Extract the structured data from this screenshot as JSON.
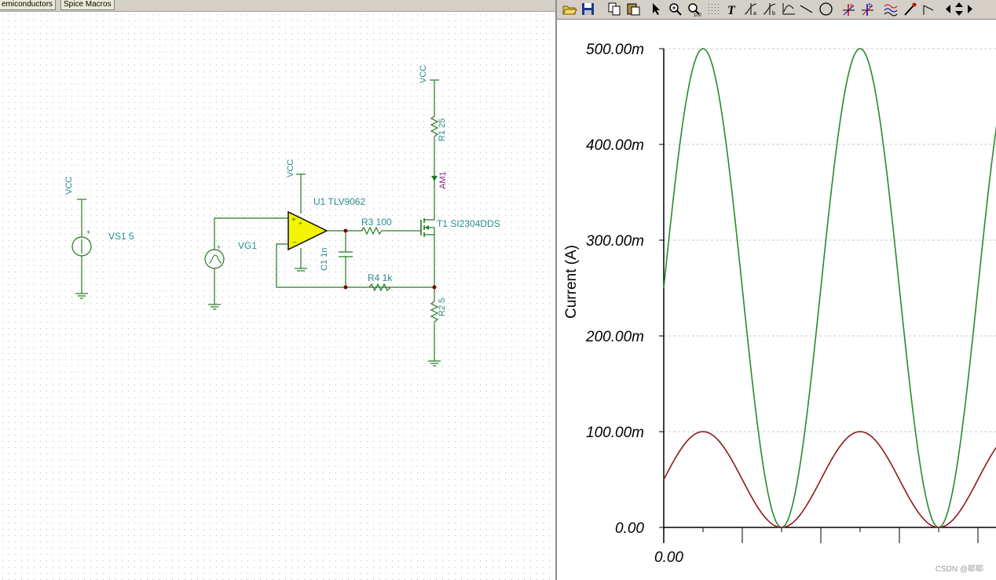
{
  "schematic": {
    "tabs": [
      {
        "label": "emiconductors"
      },
      {
        "label": "Spice Macros"
      }
    ],
    "labels": {
      "vcc1": "VCC",
      "vcc2": "VCC",
      "vcc3": "VCC",
      "vs1": "VS1 5",
      "vg1": "VG1",
      "u1": "U1 TLV9062",
      "r3": "R3 100",
      "c1": "C1 1n",
      "r4": "R4 1k",
      "r1": "R1 25",
      "am1": "AM1",
      "t1": "T1 SI2304DDS",
      "r2": "R2 5"
    },
    "colors": {
      "wire": "#207a20",
      "label": "#2a8c8c",
      "meter_label": "#8a2a8a",
      "opamp_fill": "#f5f500",
      "node": "#800000"
    }
  },
  "toolbar": {
    "buttons": [
      {
        "icon": "open-folder-icon"
      },
      {
        "icon": "save-icon"
      },
      {
        "icon": "copy-icon"
      },
      {
        "icon": "paste-icon"
      },
      {
        "icon": "pointer-icon"
      },
      {
        "icon": "zoom-in-icon"
      },
      {
        "icon": "zoom-100-icon"
      },
      {
        "icon": "grid-icon"
      },
      {
        "icon": "text-tool-icon"
      },
      {
        "icon": "cursor-a-icon"
      },
      {
        "icon": "cursor-b-icon"
      },
      {
        "icon": "axis-icon"
      },
      {
        "icon": "line-tool-icon"
      },
      {
        "icon": "ellipse-tool-icon"
      },
      {
        "icon": "cursor-a-cross-icon"
      },
      {
        "icon": "cursor-b-cross-icon"
      },
      {
        "icon": "curves-icon"
      },
      {
        "icon": "pen-tool-icon"
      },
      {
        "icon": "corner-line-icon"
      },
      {
        "icon": "arrow-left-icon"
      },
      {
        "icon": "arrow-updown-icon"
      },
      {
        "icon": "arrow-right-icon"
      }
    ]
  },
  "chart_data": {
    "type": "line",
    "ylabel": "Current  (A)",
    "yticks": [
      "0.00",
      "100.00m",
      "200.00m",
      "300.00m",
      "400.00m",
      "500.00m"
    ],
    "ylim": [
      0,
      0.5
    ],
    "xtick_first": "0.00",
    "grid": true,
    "series": [
      {
        "color": "#2a8a2a",
        "points": [
          [
            0,
            0.25
          ],
          [
            0.125,
            0.4268
          ],
          [
            0.25,
            0.5
          ],
          [
            0.375,
            0.4268
          ],
          [
            0.5,
            0.25
          ],
          [
            0.625,
            0.0732
          ],
          [
            0.75,
            0
          ],
          [
            0.875,
            0.0732
          ],
          [
            1,
            0.25
          ],
          [
            1.125,
            0.4268
          ],
          [
            1.25,
            0.5
          ],
          [
            1.375,
            0.4268
          ],
          [
            1.5,
            0.25
          ],
          [
            1.625,
            0.0732
          ],
          [
            1.75,
            0
          ],
          [
            1.875,
            0.0732
          ],
          [
            2,
            0.25
          ],
          [
            2.125,
            0.4268
          ]
        ]
      },
      {
        "color": "#8b1a1a",
        "points": [
          [
            0,
            0.05
          ],
          [
            0.125,
            0.0854
          ],
          [
            0.25,
            0.1
          ],
          [
            0.375,
            0.0854
          ],
          [
            0.5,
            0.05
          ],
          [
            0.625,
            0.0146
          ],
          [
            0.75,
            0
          ],
          [
            0.875,
            0.0146
          ],
          [
            1,
            0.05
          ],
          [
            1.125,
            0.0854
          ],
          [
            1.25,
            0.1
          ],
          [
            1.375,
            0.0854
          ],
          [
            1.5,
            0.05
          ],
          [
            1.625,
            0.0146
          ],
          [
            1.75,
            0
          ],
          [
            1.875,
            0.0146
          ],
          [
            2,
            0.05
          ],
          [
            2.125,
            0.0854
          ]
        ]
      }
    ]
  },
  "watermark": "CSDN @耶耶"
}
